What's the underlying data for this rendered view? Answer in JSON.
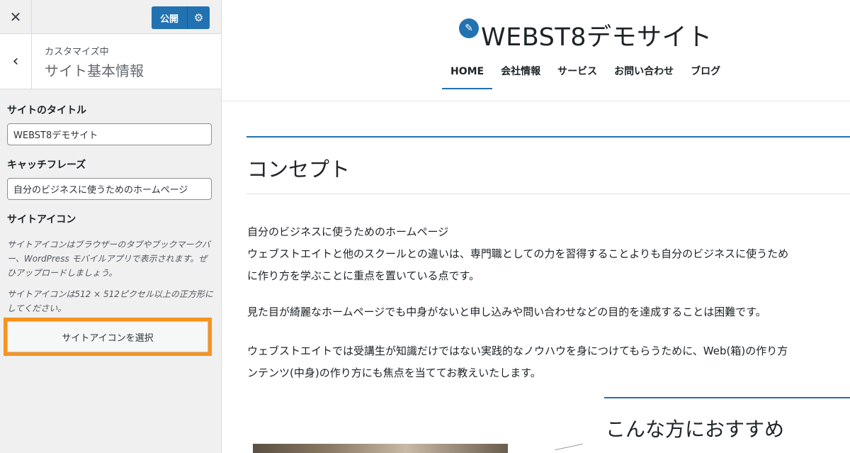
{
  "topbar": {
    "close_glyph": "✕",
    "publish_label": "公開",
    "settings_glyph": "⚙"
  },
  "section": {
    "back_glyph": "‹",
    "customizing": "カスタマイズ中",
    "title": "サイト基本情報"
  },
  "controls": {
    "site_title_label": "サイトのタイトル",
    "site_title_value": "WEBST8デモサイト",
    "tagline_label": "キャッチフレーズ",
    "tagline_value": "自分のビジネスに使うためのホームページ",
    "site_icon_label": "サイトアイコン",
    "site_icon_desc1": "サイトアイコンはブラウザーのタブやブックマークバー、WordPress モバイルアプリで表示されます。ぜひアップロードしましょう。",
    "site_icon_desc2": "サイトアイコンは512 × 512ピクセル以上の正方形にしてください。",
    "select_icon_button": "サイトアイコンを選択"
  },
  "preview": {
    "site_logo_glyph": "✎",
    "site_name": "WEBST8デモサイト",
    "nav": [
      "HOME",
      "会社情報",
      "サービス",
      "お問い合わせ",
      "ブログ"
    ],
    "concept_heading": "コンセプト",
    "para1_line1": "自分のビジネスに使うためのホームページ",
    "para1_line2": "ウェブストエイトと他のスクールとの違いは、専門職としての力を習得することよりも自分のビジネスに使うため",
    "para1_line3": "に作り方を学ぶことに重点を置いている点です。",
    "para2": "見た目が綺麗なホームページでも中身がないと申し込みや問い合わせなどの目的を達成することは困難です。",
    "para3_line1": "ウェブストエイトでは受講生が知識だけではない実践的なノウハウを身につけてもらうために、Web(箱)の作り方",
    "para3_line2": "ンテンツ(中身)の作り方にも焦点を当ててお教えいたします。",
    "recommend_heading": "こんな方におすすめ"
  },
  "colors": {
    "accent": "#2271b1",
    "highlight": "#f7931e"
  }
}
